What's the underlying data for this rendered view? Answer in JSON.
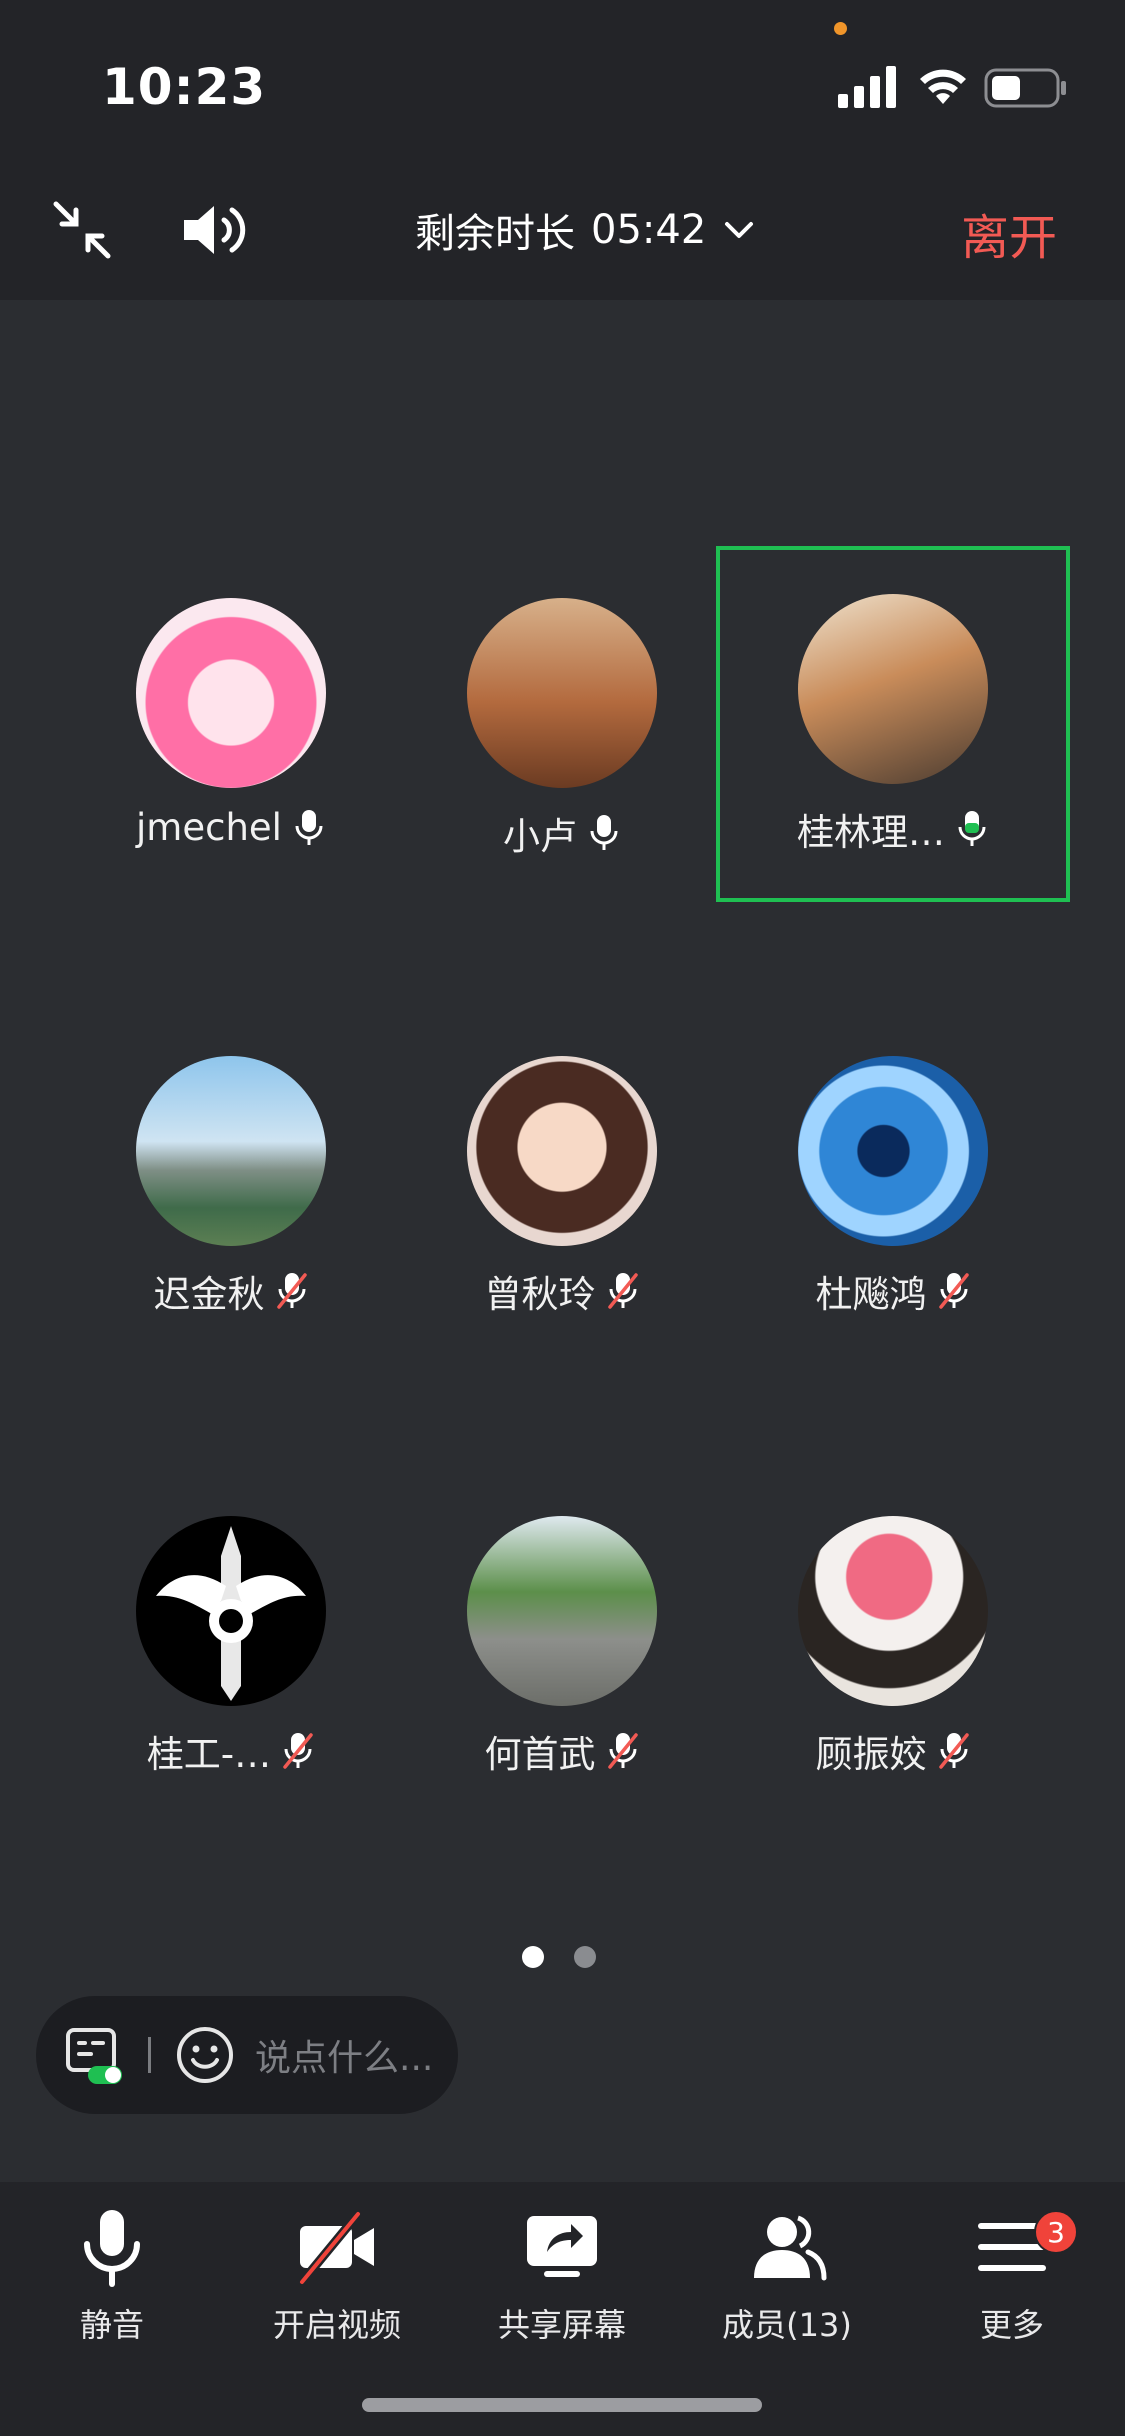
{
  "status_bar": {
    "time": "10:23"
  },
  "top_bar": {
    "timer_label": "剩余时长",
    "timer_value": "05:42",
    "leave_label": "离开"
  },
  "colors": {
    "leave": "#f25a54",
    "speaking_border": "#1fbf52",
    "badge": "#f0433a"
  },
  "participants": [
    {
      "name": "jmechel",
      "mic": "on",
      "avatar": "anime-girl"
    },
    {
      "name": "小卢",
      "mic": "on",
      "avatar": "jumping-person"
    },
    {
      "name": "桂林理…",
      "mic": "speaking",
      "avatar": "two-people-road"
    },
    {
      "name": "迟金秋",
      "mic": "muted",
      "avatar": "city-river"
    },
    {
      "name": "曾秋玲",
      "mic": "muted",
      "avatar": "illustrated-girl"
    },
    {
      "name": "杜飚鸿",
      "mic": "muted",
      "avatar": "blue-wave"
    },
    {
      "name": "桂工-…",
      "mic": "muted",
      "avatar": "dragon-sword"
    },
    {
      "name": "何首武",
      "mic": "muted",
      "avatar": "park-path"
    },
    {
      "name": "顾振姣",
      "mic": "muted",
      "avatar": "pink-hat-woman"
    }
  ],
  "pager": {
    "pages": 2,
    "active": 1
  },
  "chat": {
    "placeholder": "说点什么..."
  },
  "toolbar": {
    "mute_label": "静音",
    "video_label": "开启视频",
    "share_label": "共享屏幕",
    "members_label": "成员(13)",
    "more_label": "更多",
    "more_badge": "3"
  }
}
